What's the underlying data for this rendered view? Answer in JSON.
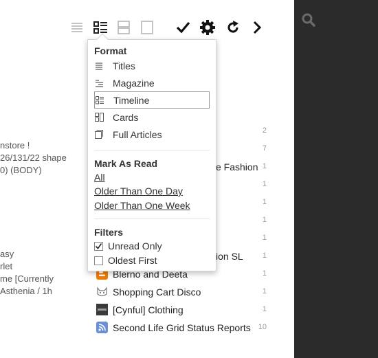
{
  "toolbar": {
    "icons": [
      "titles-view-icon",
      "timeline-view-icon",
      "cards-view-icon",
      "full-articles-view-icon",
      "mark-read-check-icon",
      "settings-gear-icon",
      "refresh-icon",
      "next-chevron-icon"
    ]
  },
  "left_text": [
    "nstore !",
    "26/131/22 shape",
    "0) (BODY)",
    "asy",
    "rlet",
    "me [Currently",
    "Asthenia / 1h"
  ],
  "feeds": [
    {
      "title": "e Fashion",
      "count": "1"
    },
    {
      "title": "ion SL",
      "count": "1"
    },
    {
      "title": "Blerno and Deeta",
      "count": "1"
    },
    {
      "title": "Shopping Cart Disco",
      "count": "1"
    },
    {
      "title": "[Cynful] Clothing",
      "count": "1"
    },
    {
      "title": "Second Life Grid Status Reports",
      "count": "10"
    }
  ],
  "counts_column": [
    "2",
    "7",
    "1",
    "1",
    "1",
    "1",
    "1",
    "1",
    "1",
    "1",
    "1",
    "10"
  ],
  "menu": {
    "format_heading": "Format",
    "format_items": [
      {
        "label": "Titles",
        "icon": "titles-icon"
      },
      {
        "label": "Magazine",
        "icon": "magazine-icon"
      },
      {
        "label": "Timeline",
        "icon": "timeline-icon"
      },
      {
        "label": "Cards",
        "icon": "cards-icon"
      },
      {
        "label": "Full Articles",
        "icon": "full-articles-icon"
      }
    ],
    "selected_format": "Timeline",
    "mark_heading": "Mark As Read",
    "mark_items": [
      "All",
      "Older Than One Day",
      "Older Than One Week"
    ],
    "filters_heading": "Filters",
    "filters": [
      {
        "label": "Unread Only",
        "checked": true
      },
      {
        "label": "Oldest First",
        "checked": false
      }
    ]
  },
  "colors": {
    "panel": "#2b2b2b",
    "toolbar_inactive": "#c4c4c4",
    "toolbar_active": "#222222",
    "rss": "#6b8fd6",
    "blogger": "#f57d00"
  }
}
